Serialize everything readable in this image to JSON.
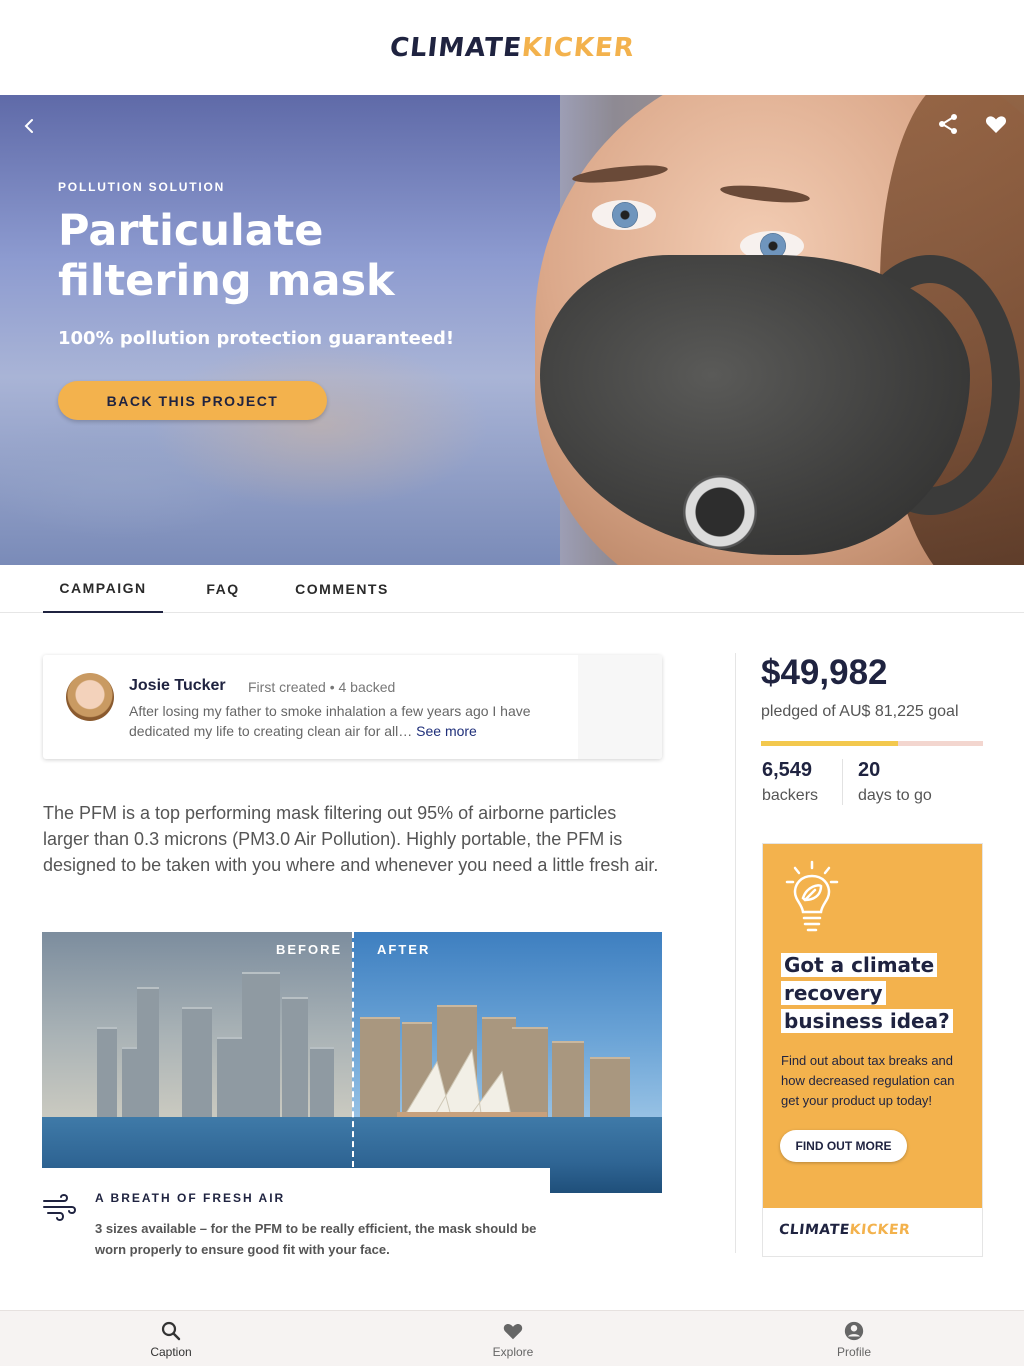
{
  "brand": {
    "part1": "CLIMATE",
    "part2": "KICKER"
  },
  "hero": {
    "eyebrow": "POLLUTION SOLUTION",
    "title": "Particulate filtering mask",
    "subtitle": "100% pollution protection guaranteed!",
    "cta": "BACK THIS PROJECT"
  },
  "tabs": [
    {
      "label": "CAMPAIGN",
      "active": true
    },
    {
      "label": "FAQ",
      "active": false
    },
    {
      "label": "COMMENTS",
      "active": false
    }
  ],
  "creator": {
    "name": "Josie Tucker",
    "meta": "First created • 4 backed",
    "bio": "After losing my father to smoke inhalation a few years ago I have dedicated my life to creating clean air for all…",
    "see_more": "See more"
  },
  "description": "The PFM is a top performing mask filtering out 95% of airborne particles larger than 0.3 microns (PM3.0 Air Pollution). Highly portable, the PFM is designed to be taken with you where and whenever you need a little fresh air.",
  "comparison": {
    "before": "BEFORE",
    "after": "AFTER"
  },
  "feature": {
    "title": "A BREATH OF FRESH AIR",
    "text": "3 sizes available – for the PFM to be really efficient, the mask should be worn properly to ensure good fit with your face."
  },
  "funding": {
    "pledged": "$49,982",
    "goal_text": "pledged of AU$ 81,225 goal",
    "progress_fraction": 0.615,
    "backers_num": "6,549",
    "backers_label": "backers",
    "days_num": "20",
    "days_label": "days to go"
  },
  "ad": {
    "headline_lines": [
      "Got a climate",
      "recovery",
      "business idea?"
    ],
    "text": "Find out about tax breaks and how decreased regulation can get your product up today!",
    "cta": "FIND OUT MORE"
  },
  "bottom_nav": [
    {
      "label": "Caption",
      "icon": "search-icon"
    },
    {
      "label": "Explore",
      "icon": "heart-icon"
    },
    {
      "label": "Profile",
      "icon": "profile-icon"
    }
  ],
  "colors": {
    "navy": "#1f2340",
    "accent": "#f3b24d",
    "progress_track": "#f3d6cf",
    "progress_fill": "#f3c84d"
  }
}
